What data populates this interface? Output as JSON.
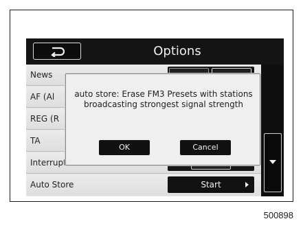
{
  "header": {
    "title": "Options",
    "back_icon": "return-arrow-icon"
  },
  "rows": [
    {
      "label": "News"
    },
    {
      "label": "AF (Al"
    },
    {
      "label": "REG (R"
    },
    {
      "label": "TA"
    },
    {
      "label": "Interrupt Volume"
    },
    {
      "label": "Auto Store",
      "button": "Start"
    }
  ],
  "scroll": {
    "icon": "scroll-down-icon"
  },
  "dialog": {
    "message": "auto store: Erase FM3 Presets with stations broadcasting strongest signal strength",
    "ok_label": "OK",
    "cancel_label": "Cancel"
  },
  "figure_id": "500898"
}
